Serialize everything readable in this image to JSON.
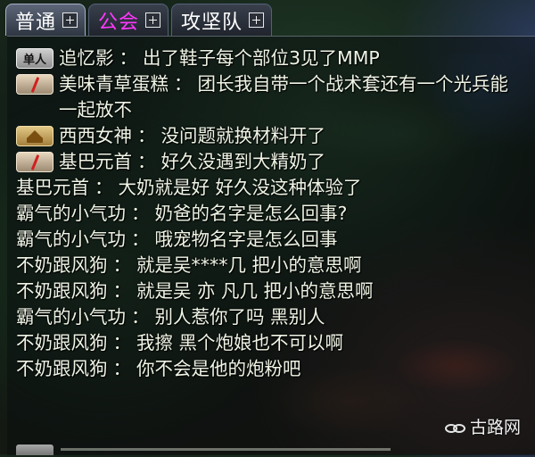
{
  "tabs": [
    {
      "label": "普通",
      "active": true,
      "color": "#ffffff"
    },
    {
      "label": "公会",
      "active": false,
      "color": "#ff38ff"
    },
    {
      "label": "攻坚队",
      "active": false,
      "color": "#ffffff"
    }
  ],
  "badges": {
    "solo_label": "单人"
  },
  "messages": [
    {
      "badge": "solo",
      "sender": "追忆影",
      "sep": "：",
      "text": "出了鞋子每个部位3见了MMP"
    },
    {
      "badge": "team",
      "sender": "美味青草蛋糕",
      "sep": "：",
      "text": "团长我自带一个战术套还有一个光兵能一起放不"
    },
    {
      "badge": "guild",
      "sender": "西西女神",
      "sep": "：",
      "text": "没问题就换材料开了"
    },
    {
      "badge": "team",
      "sender": "基巴元首",
      "sep": "：",
      "text": "好久没遇到大精奶了"
    },
    {
      "badge": "none",
      "sender": "基巴元首",
      "sep": "：",
      "text": "大奶就是好 好久没这种体验了"
    },
    {
      "badge": "none",
      "sender": "霸气的小气功",
      "sep": "：",
      "text": "奶爸的名字是怎么回事?"
    },
    {
      "badge": "none",
      "sender": "霸气的小气功",
      "sep": "：",
      "text": "哦宠物名字是怎么回事"
    },
    {
      "badge": "none",
      "sender": "不奶跟风狗",
      "sep": "：",
      "text": "就是吴****几 把小的意思啊"
    },
    {
      "badge": "none",
      "sender": "不奶跟风狗",
      "sep": "：",
      "text": "就是吴 亦 凡几 把小的意思啊"
    },
    {
      "badge": "none",
      "sender": "霸气的小气功",
      "sep": "：",
      "text": "别人惹你了吗 黑别人"
    },
    {
      "badge": "none",
      "sender": "不奶跟风狗",
      "sep": "：",
      "text": "我擦 黑个炮娘也不可以啊"
    },
    {
      "badge": "none",
      "sender": "不奶跟风狗",
      "sep": "：",
      "text": "你不会是他的炮粉吧"
    }
  ],
  "watermark": {
    "text": "古路网"
  },
  "colors": {
    "chat_text": "#eff5e5",
    "guild_tab": "#ff38ff",
    "team_slash": "#d11f1f"
  }
}
